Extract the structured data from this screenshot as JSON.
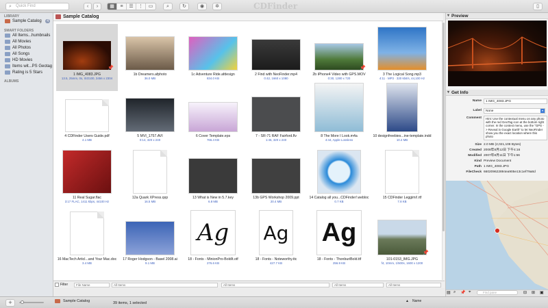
{
  "toolbar": {
    "search_placeholder": "Quick Find",
    "logo": "CDFinder"
  },
  "sidebar": {
    "library_header": "LIBRARY",
    "library_items": [
      {
        "label": "Sample Catalog",
        "count": "4"
      }
    ],
    "smart_header": "SMART FOLDERS",
    "smart_items": [
      {
        "label": "All Items...humbnails"
      },
      {
        "label": "All Movies"
      },
      {
        "label": "All Photos"
      },
      {
        "label": "All Songs"
      },
      {
        "label": "HD Movies"
      },
      {
        "label": "Items wit...PS Geotag"
      },
      {
        "label": "Rating is 5 Stars"
      }
    ],
    "albums_header": "ALBUMS"
  },
  "main": {
    "title": "Sample Catalog",
    "items": [
      {
        "name": "1 IMG_4083.JPG",
        "sub": "13.5, 25mm, 0s, ISO100, 3456 x 2304",
        "selected": true,
        "pin": true
      },
      {
        "name": "1b Dreamers.afphoto",
        "sub": "36.0 MB"
      },
      {
        "name": "1c Adventure Ride.afdesign",
        "sub": "834.0 KB"
      },
      {
        "name": "2 Find with NeoFinder.mp4",
        "sub": "0:42, 1660 x 1080"
      },
      {
        "name": "2b iPhone4 Video with GPS.MOV",
        "sub": "0:30, 1280 x 720",
        "pin": true
      },
      {
        "name": "3 The Logical Song.mp3",
        "sub": "4:11 · MP3 · 320 kbit/s, 44,100 Hz"
      },
      {
        "name": "4 CDFinder Users Guide.pdf",
        "sub": "4.1 MB"
      },
      {
        "name": "5 MVI_1757.AVI",
        "sub": "0:14, 320 x 240"
      },
      {
        "name": "6 Cover Template.eps",
        "sub": "766.4 KB"
      },
      {
        "name": "7 - SR-71 RAF Fairford.flv",
        "sub": "1:46, 320 x 240"
      },
      {
        "name": "8 The More I Look.m4a",
        "sub": "4:44, Apple Lossless"
      },
      {
        "name": "10 designfreebies...ine-template.indd",
        "sub": "10.4 MB"
      },
      {
        "name": "11 Real Sugar.flac",
        "sub": "3:17 FLAC, 1411 kbps, 44100 Hz"
      },
      {
        "name": "12a Quark XPress.qxp",
        "sub": "16.5 MB"
      },
      {
        "name": "13 What is New in 5.7.key",
        "sub": "6.8 MB"
      },
      {
        "name": "13b GPS Workshop 2009.ppt",
        "sub": "20.4 MB"
      },
      {
        "name": "14 Catalog all you...CDFinder!.webloc",
        "sub": "0.7 KB"
      },
      {
        "name": "15 CDFinder Leggimi!.rtf",
        "sub": "7.8 KB"
      },
      {
        "name": "16 MacTech Articl...and Your Mac.doc",
        "sub": "3.4 MB"
      },
      {
        "name": "17 Roger Hodgson - Basel 2008.ai",
        "sub": "9.1 MB"
      },
      {
        "name": "18 - Fonts - MinionPro-BoldIt.otf",
        "sub": "276.6 KB"
      },
      {
        "name": "18 - Fonts - Noteworthy.ttc",
        "sub": "427.7 KB"
      },
      {
        "name": "18 - Fonts - ThonburiBold.ttf",
        "sub": "256.9 KB"
      },
      {
        "name": "101-0153_IMG.JPG",
        "sub": "f4, 10mm, 1/500s, 1600 x 1200",
        "pin": true
      }
    ]
  },
  "filter": {
    "label": "Filter",
    "placeholder": "File Name",
    "selects": [
      "All Items",
      "All Items",
      "All Items",
      "All Items"
    ]
  },
  "status": {
    "catalog": "Sample Catalog",
    "count": "39 items, 1 selected",
    "sort": "Name"
  },
  "panel": {
    "preview_title": "Preview",
    "info_title": "Get Info",
    "name_label": "Name",
    "name_value": "1 IMG_4083.JPG",
    "label_label": "Label",
    "label_value": "None",
    "comment_label": "Comment",
    "comment_value": "Hint: Use the contextual menu on any photo with the red GeoTag icon at the bottom right corner. In the context menu, use the \"GPS -> Reveal in Google Earth\" to let NeoFinder show you the exact location where this photo",
    "rows": [
      {
        "k": "Size",
        "v": "2.0 MB (2,021,108 Bytes)"
      },
      {
        "k": "Created",
        "v": "2008年8月12日 下午4:16"
      },
      {
        "k": "Modified",
        "v": "2007年8月11日 下午1:56"
      },
      {
        "k": "Kind",
        "v": "Preview Document"
      },
      {
        "k": "Path",
        "v": "1 IMG_4083.JPG"
      },
      {
        "k": "FileCheck",
        "v": "660209622894ea905e13c1ef79a8d"
      }
    ],
    "map_label": "Map",
    "find_placeholder": "Find pane"
  },
  "colors": {
    "accent": "#3b5fbf",
    "selection": "#d8d8d8",
    "pin": "#c02020"
  }
}
